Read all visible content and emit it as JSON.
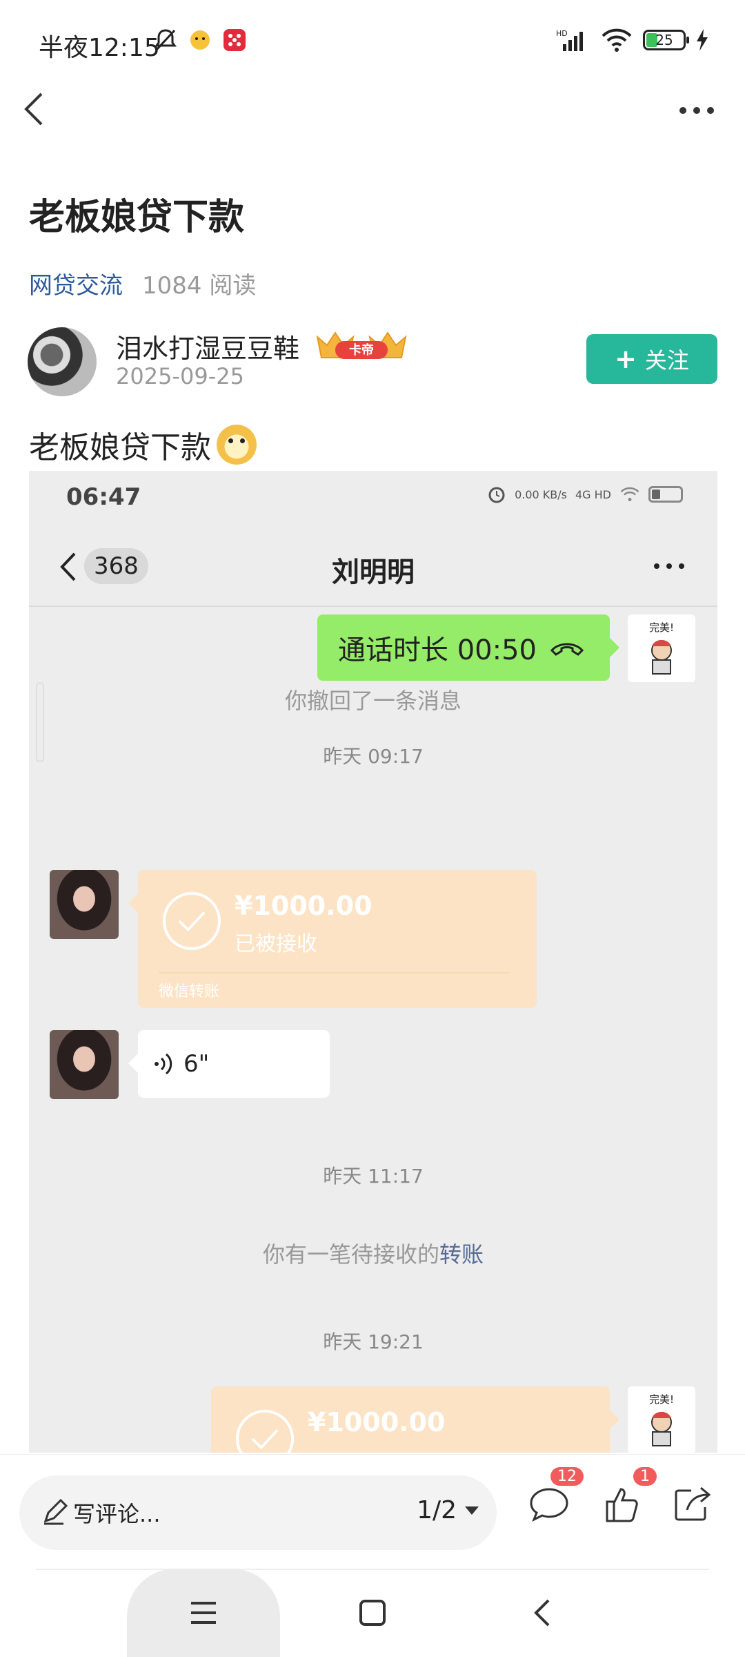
{
  "status_bar": {
    "time": "半夜12:15",
    "battery": "25"
  },
  "article": {
    "title": "老板娘贷下款",
    "category": "网贷交流",
    "reads": "1084 阅读",
    "author_name": "泪水打湿豆豆鞋",
    "author_badge": "卡帝",
    "date": "2025-09-25",
    "follow_label": "关注",
    "body_text": "老板娘贷下款"
  },
  "screenshot": {
    "time": "06:47",
    "net_speed": "0.00 KB/s",
    "network": "4G HD",
    "unread_count": "368",
    "contact_name": "刘明明",
    "call_text": "通话时长 00:50",
    "recalled": "你撤回了一条消息",
    "ts1": "昨天 09:17",
    "transfer_amount": "¥1000.00",
    "transfer_status": "已被接收",
    "transfer_footer": "微信转账",
    "voice_len": "6\"",
    "ts2": "昨天 11:17",
    "pending_prefix": "你有一笔待接收的",
    "pending_link": "转账",
    "ts3": "昨天 19:21",
    "transfer2_amount": "¥1000.00",
    "sticker_text": "完美!"
  },
  "bottom_bar": {
    "comment_placeholder": "写评论...",
    "page_indicator": "1/2",
    "comment_count": "12",
    "like_count": "1"
  }
}
